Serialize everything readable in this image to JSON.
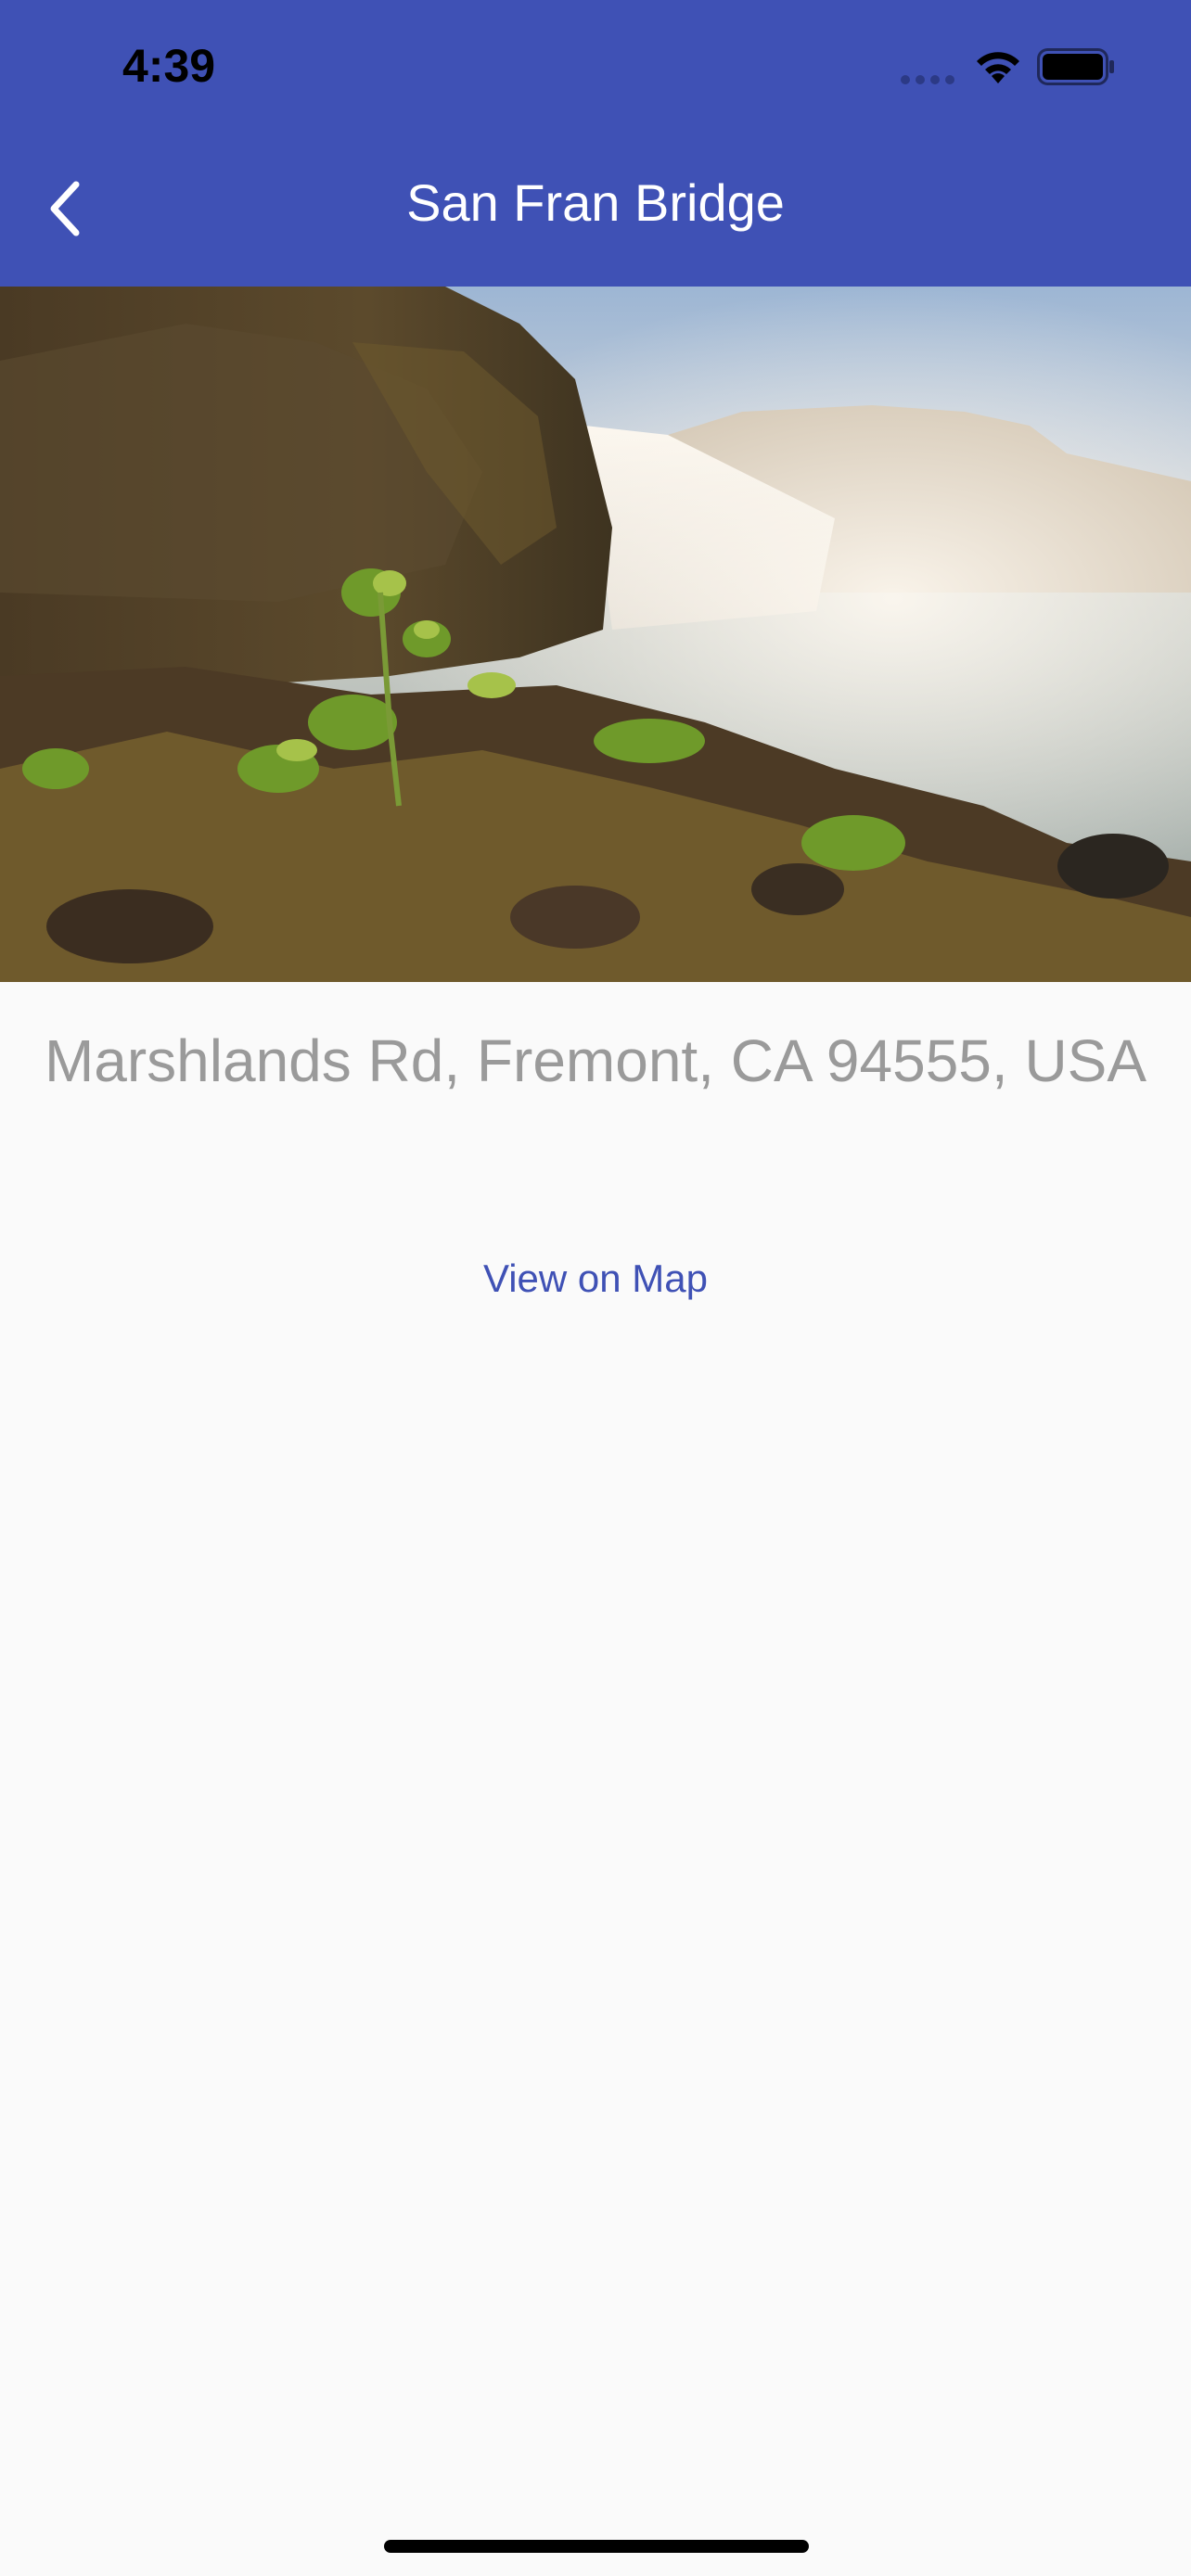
{
  "status_bar": {
    "time": "4:39"
  },
  "app_bar": {
    "title": "San Fran Bridge",
    "back_icon": "chevron-left-icon",
    "background_color": "#3f51b5"
  },
  "hero_image": {
    "subject": "waterfall landscape photo"
  },
  "detail": {
    "address": "Marshlands Rd, Fremont, CA 94555, USA",
    "map_link_label": "View on Map",
    "link_color": "#3f51b5"
  }
}
